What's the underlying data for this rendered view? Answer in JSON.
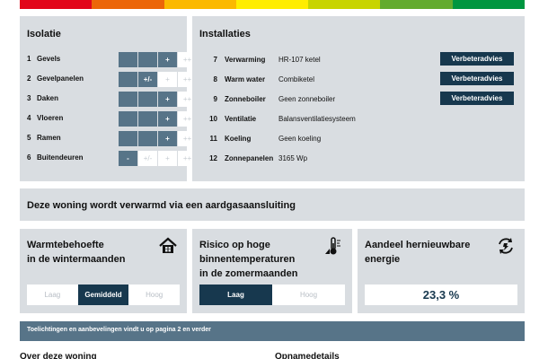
{
  "colors": [
    "#e2061a",
    "#ec6608",
    "#fbb900",
    "#ffed00",
    "#c8d400",
    "#63ab2e",
    "#009640"
  ],
  "isolatie": {
    "title": "Isolatie",
    "rows": [
      {
        "num": "1",
        "label": "Gevels",
        "cells": [
          "",
          "",
          "+",
          "++"
        ],
        "filled": 3
      },
      {
        "num": "2",
        "label": "Gevelpanelen",
        "cells": [
          "",
          "+/-",
          "+",
          "++"
        ],
        "filled": 2
      },
      {
        "num": "3",
        "label": "Daken",
        "cells": [
          "",
          "",
          "+",
          "++"
        ],
        "filled": 3
      },
      {
        "num": "4",
        "label": "Vloeren",
        "cells": [
          "",
          "",
          "+",
          "++"
        ],
        "filled": 3
      },
      {
        "num": "5",
        "label": "Ramen",
        "cells": [
          "",
          "",
          "+",
          "++"
        ],
        "filled": 3
      },
      {
        "num": "6",
        "label": "Buitendeuren",
        "cells": [
          "-",
          "+/-",
          "+",
          "++"
        ],
        "filled": 1
      }
    ]
  },
  "installaties": {
    "title": "Installaties",
    "button_label": "Verbeteradvies",
    "rows": [
      {
        "num": "7",
        "label": "Verwarming",
        "value": "HR-107 ketel",
        "button": true
      },
      {
        "num": "8",
        "label": "Warm water",
        "value": "Combiketel",
        "button": true
      },
      {
        "num": "9",
        "label": "Zonneboiler",
        "value": "Geen zonneboiler",
        "button": true
      },
      {
        "num": "10",
        "label": "Ventilatie",
        "value": "Balansventilatiesysteem",
        "button": false
      },
      {
        "num": "11",
        "label": "Koeling",
        "value": "Geen koeling",
        "button": false
      },
      {
        "num": "12",
        "label": "Zonnepanelen",
        "value": "3165 Wp",
        "button": false
      }
    ]
  },
  "verwarming": {
    "text": "Deze woning wordt verwarmd via een aardgasaansluiting"
  },
  "warmte": {
    "title_line1": "Warmtebehoefte",
    "title_line2": "in de wintermaanden",
    "icon": "house-icon",
    "options": [
      "Laag",
      "Gemiddeld",
      "Hoog"
    ],
    "selected": 1
  },
  "risico": {
    "title_line1": "Risico op hoge",
    "title_line2": "binnentemperaturen",
    "title_line3": "in de zomermaanden",
    "icon": "thermometer-icon",
    "options": [
      "Laag",
      "Hoog"
    ],
    "selected": 0
  },
  "hernieuw": {
    "title_line1": "Aandeel hernieuwbare",
    "title_line2": "energie",
    "icon": "recycle-icon",
    "value": "23,3 %"
  },
  "toelichting": {
    "text": "Toelichtingen en aanbevelingen vindt u op pagina 2 en verder"
  },
  "footer": {
    "left": "Over deze woning",
    "right": "Opnamedetails"
  }
}
